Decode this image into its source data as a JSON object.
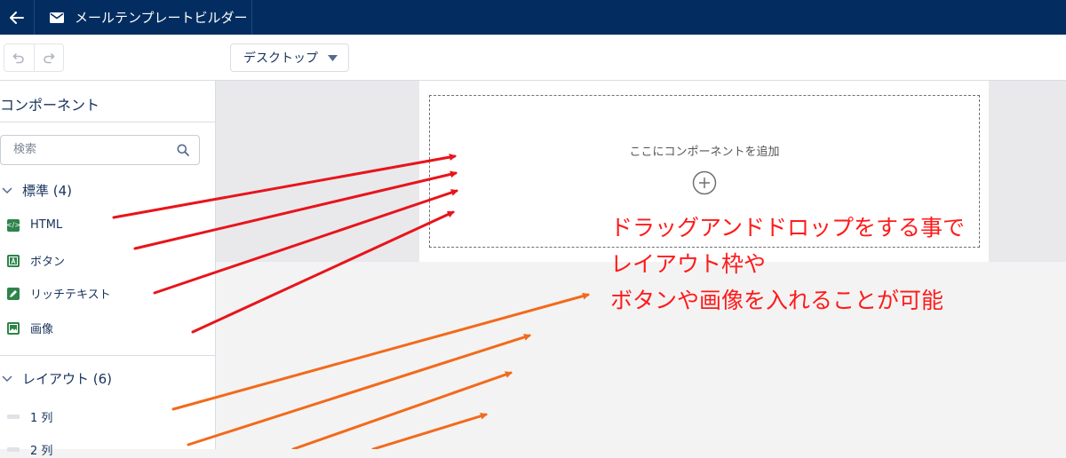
{
  "header": {
    "title": "メールテンプレートビルダー",
    "back_icon": "back-arrow-icon",
    "title_icon": "mail-icon",
    "bg_color": "#032d60"
  },
  "toolbar": {
    "device_select": {
      "selected": "デスクトップ"
    }
  },
  "sidebar": {
    "title": "コンポーネント",
    "search": {
      "placeholder": "検索",
      "value": ""
    },
    "sections": [
      {
        "label": "標準 (4)",
        "expanded": true,
        "items": [
          {
            "label": "HTML",
            "icon": "html-icon"
          },
          {
            "label": "ボタン",
            "icon": "button-icon"
          },
          {
            "label": "リッチテキスト",
            "icon": "rich-text-icon"
          },
          {
            "label": "画像",
            "icon": "image-icon"
          }
        ]
      },
      {
        "label": "レイアウト (6)",
        "expanded": true,
        "items": [
          {
            "label": "1 列",
            "icon": "column-icon"
          },
          {
            "label": "2 列",
            "icon": "column-icon"
          }
        ]
      }
    ]
  },
  "canvas": {
    "dropzone_label": "ここにコンポーネントを追加",
    "add_icon": "add-circle-icon"
  },
  "annotation": {
    "lines": [
      "ドラッグアンドドロップをする事で",
      "レイアウト枠や",
      "ボタンや画像を入れることが可能"
    ],
    "color": "#ff1a1a",
    "arrow_colors": {
      "standard": "#e8141b",
      "layout": "#f26a1b"
    }
  }
}
